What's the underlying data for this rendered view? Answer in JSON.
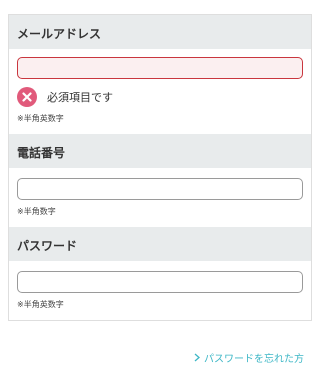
{
  "email": {
    "label": "メールアドレス",
    "value": "",
    "error_text": "必須項目です",
    "note": "※半角英数字"
  },
  "phone": {
    "label": "電話番号",
    "value": "",
    "note": "※半角数字"
  },
  "password": {
    "label": "パスワード",
    "value": "",
    "note": "※半角英数字"
  },
  "forgot_password_link": "パスワードを忘れた方",
  "colors": {
    "error_border": "#c9363e",
    "error_icon": "#e15a7b",
    "link": "#3db7c6",
    "section_header_bg": "#e8ebec"
  },
  "icons": {
    "error": "error-x-icon",
    "link_chevron": "chevron-right-icon"
  }
}
